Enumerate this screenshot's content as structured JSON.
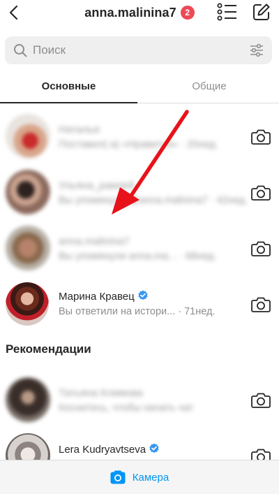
{
  "header": {
    "title": "anna.malinina7",
    "badge_count": "2",
    "icons": [
      "back-icon",
      "list-icon",
      "compose-icon"
    ]
  },
  "search": {
    "placeholder": "Поиск",
    "value": ""
  },
  "tabs": [
    {
      "label": "Основные",
      "active": true
    },
    {
      "label": "Общие",
      "active": false
    }
  ],
  "threads": [
    {
      "name": "Наталья",
      "subtitle": "Поставил(-а) «Нравится» · 20нед.",
      "blurred": true
    },
    {
      "name": "Ульяна_рамзей",
      "subtitle": "Вы упомянули @anna.malinina7 · 42нед.",
      "blurred": true
    },
    {
      "name": "anna.malinina7",
      "subtitle": "Вы упомянули anna.ma... · 68нед.",
      "blurred": true
    },
    {
      "name": "Марина Кравец",
      "subtitle": "Вы ответили на истори...",
      "time": "· 71нед.",
      "verified": true,
      "blurred": false
    }
  ],
  "recommendations": {
    "title": "Рекомендации",
    "items": [
      {
        "name": "Татьяна Климова",
        "subtitle": "Коснитесь, чтобы начать чат",
        "blurred": true
      },
      {
        "name": "Lera Kudryavtseva",
        "subtitle": "",
        "verified": true,
        "blurred": false
      }
    ]
  },
  "bottom_bar": {
    "camera_label": "Камера"
  },
  "colors": {
    "accent_blue": "#0095f6",
    "badge_red": "#ed4956",
    "arrow_red": "#e8131a",
    "verified_blue": "#3897f0"
  }
}
